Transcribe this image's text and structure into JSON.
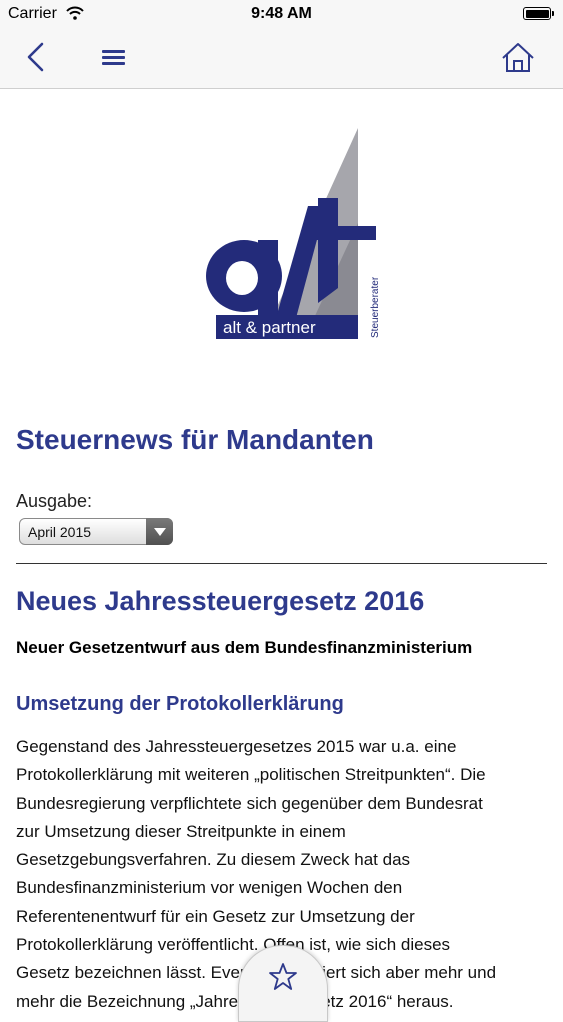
{
  "status_bar": {
    "carrier": "Carrier",
    "time": "9:48 AM",
    "wifi_icon": "wifi-icon",
    "battery_icon": "battery-full-icon",
    "battery_level": 1.0
  },
  "nav_bar": {
    "back_icon": "chevron-left-icon",
    "menu_icon": "hamburger-menu-icon",
    "home_icon": "home-icon",
    "icon_color": "#2e3a8c"
  },
  "logo": {
    "wordmark": "alt",
    "name": "alt & partner",
    "tagline": "Steuerberater"
  },
  "page": {
    "title": "Steuernews für Mandanten",
    "issue_label": "Ausgabe:",
    "issue_selected": "April 2015"
  },
  "article": {
    "title": "Neues Jahressteuergesetz 2016",
    "subtitle": "Neuer Gesetzentwurf aus dem Bundesfinanzministerium",
    "section_heading": "Umsetzung der Protokollerklärung",
    "body_lines": [
      "Gegenstand des Jahressteuergesetzes 2015 war u.a. eine",
      "Protokollerklärung mit weiteren „politischen Streitpunkten“. Die",
      "Bundesregierung verpflichtete sich gegenüber dem Bundesrat",
      "zur Umsetzung dieser Streitpunkte in einem",
      "Gesetzgebungsverfahren. Zu diesem Zweck hat das",
      "Bundesfinanzministerium vor wenigen Wochen den",
      "Referentenentwurf für ein Gesetz zur Umsetzung der",
      "Protokollerklärung veröffentlicht. Offen ist, wie sich dieses",
      "Gesetz bezeichnen lässt. Eventuell etabliert sich aber mehr und",
      "mehr die Bezeichnung „Jahressteuergesetz 2016“ heraus."
    ]
  },
  "favorite": {
    "icon": "star-icon"
  },
  "colors": {
    "brand": "#2e3a8c",
    "logo_blue": "#232b7a",
    "logo_gray": "#a6a6ac",
    "navbar_bg": "#f7f7f7"
  }
}
